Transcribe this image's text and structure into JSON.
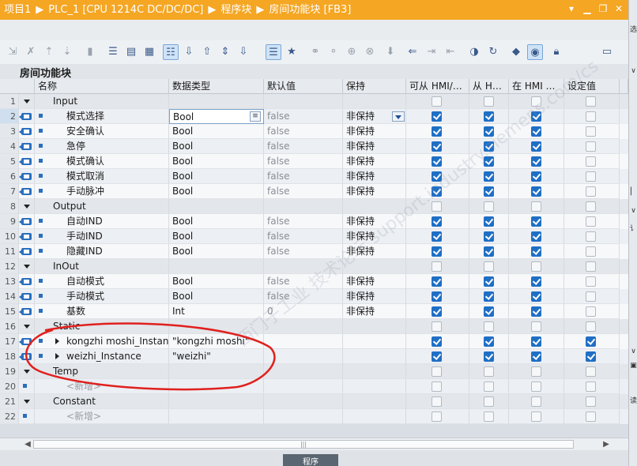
{
  "title": {
    "parts": [
      "项目1",
      "PLC_1 [CPU 1214C DC/DC/DC]",
      "程序块",
      "房间功能块 [FB3]"
    ],
    "separator": "▶"
  },
  "block_title": "房间功能块",
  "headers": {
    "name": "名称",
    "type": "数据类型",
    "default": "默认值",
    "retain": "保持",
    "hmi_access": "可从 HMI/…",
    "hmi_from": "从 H…",
    "hmi_in": "在 HMI …",
    "setpoint": "设定值"
  },
  "rows": [
    {
      "n": "1",
      "kind": "section",
      "name": "Input",
      "type": "",
      "default": "",
      "retain": "",
      "cb": [
        0,
        0,
        0,
        0
      ]
    },
    {
      "n": "2",
      "kind": "var",
      "name": "模式选择",
      "type": "Bool",
      "default": "false",
      "retain": "非保持",
      "cb": [
        1,
        1,
        1,
        0
      ],
      "selected": true
    },
    {
      "n": "3",
      "kind": "var",
      "name": "安全确认",
      "type": "Bool",
      "default": "false",
      "retain": "非保持",
      "cb": [
        1,
        1,
        1,
        0
      ]
    },
    {
      "n": "4",
      "kind": "var",
      "name": "急停",
      "type": "Bool",
      "default": "false",
      "retain": "非保持",
      "cb": [
        1,
        1,
        1,
        0
      ]
    },
    {
      "n": "5",
      "kind": "var",
      "name": "模式确认",
      "type": "Bool",
      "default": "false",
      "retain": "非保持",
      "cb": [
        1,
        1,
        1,
        0
      ]
    },
    {
      "n": "6",
      "kind": "var",
      "name": "模式取消",
      "type": "Bool",
      "default": "false",
      "retain": "非保持",
      "cb": [
        1,
        1,
        1,
        0
      ]
    },
    {
      "n": "7",
      "kind": "var",
      "name": "手动脉冲",
      "type": "Bool",
      "default": "false",
      "retain": "非保持",
      "cb": [
        1,
        1,
        1,
        0
      ]
    },
    {
      "n": "8",
      "kind": "section",
      "name": "Output",
      "type": "",
      "default": "",
      "retain": "",
      "cb": [
        0,
        0,
        0,
        0
      ]
    },
    {
      "n": "9",
      "kind": "var",
      "name": "自动IND",
      "type": "Bool",
      "default": "false",
      "retain": "非保持",
      "cb": [
        1,
        1,
        1,
        0
      ]
    },
    {
      "n": "10",
      "kind": "var",
      "name": "手动IND",
      "type": "Bool",
      "default": "false",
      "retain": "非保持",
      "cb": [
        1,
        1,
        1,
        0
      ]
    },
    {
      "n": "11",
      "kind": "var",
      "name": "隐藏IND",
      "type": "Bool",
      "default": "false",
      "retain": "非保持",
      "cb": [
        1,
        1,
        1,
        0
      ]
    },
    {
      "n": "12",
      "kind": "section",
      "name": "InOut",
      "type": "",
      "default": "",
      "retain": "",
      "cb": [
        0,
        0,
        0,
        0
      ]
    },
    {
      "n": "13",
      "kind": "var",
      "name": "自动模式",
      "type": "Bool",
      "default": "false",
      "retain": "非保持",
      "cb": [
        1,
        1,
        1,
        0
      ]
    },
    {
      "n": "14",
      "kind": "var",
      "name": "手动模式",
      "type": "Bool",
      "default": "false",
      "retain": "非保持",
      "cb": [
        1,
        1,
        1,
        0
      ]
    },
    {
      "n": "15",
      "kind": "var",
      "name": "基数",
      "type": "Int",
      "default": "0",
      "retain": "非保持",
      "cb": [
        1,
        1,
        1,
        0
      ]
    },
    {
      "n": "16",
      "kind": "section",
      "name": "Static",
      "type": "",
      "default": "",
      "retain": "",
      "cb": [
        0,
        0,
        0,
        0
      ]
    },
    {
      "n": "17",
      "kind": "instance",
      "name": "kongzhi moshi_Instan...",
      "type": "\"kongzhi moshi\"",
      "default": "",
      "retain": "",
      "cb": [
        1,
        1,
        1,
        1
      ]
    },
    {
      "n": "18",
      "kind": "instance",
      "name": "weizhi_Instance",
      "type": "\"weizhi\"",
      "default": "",
      "retain": "",
      "cb": [
        1,
        1,
        1,
        1
      ]
    },
    {
      "n": "19",
      "kind": "section",
      "name": "Temp",
      "type": "",
      "default": "",
      "retain": "",
      "cb": [
        0,
        0,
        0,
        0
      ]
    },
    {
      "n": "20",
      "kind": "add",
      "name": "<新增>",
      "type": "",
      "default": "",
      "retain": "",
      "cb": [
        0,
        0,
        0,
        0
      ]
    },
    {
      "n": "21",
      "kind": "section",
      "name": "Constant",
      "type": "",
      "default": "",
      "retain": "",
      "cb": [
        0,
        0,
        0,
        0
      ]
    },
    {
      "n": "22",
      "kind": "add",
      "name": "<新增>",
      "type": "",
      "default": "",
      "retain": "",
      "cb": [
        0,
        0,
        0,
        0
      ]
    }
  ],
  "footer_tab": "程序",
  "watermark": "西门子工业 技术论坛 support.industry.siemens.com/cs",
  "colors": {
    "titlebar": "#f5a623",
    "check": "#1f6fc5",
    "annotation": "#e0201e"
  }
}
